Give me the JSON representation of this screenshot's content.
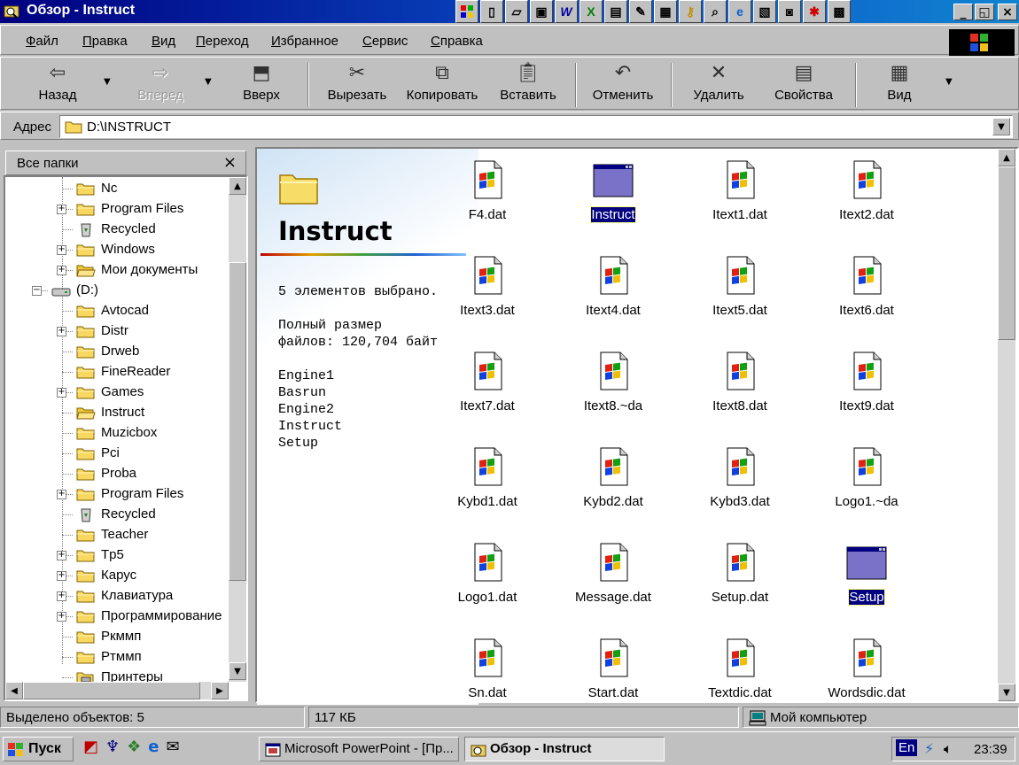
{
  "window": {
    "title": "Обзор - Instruct"
  },
  "menu": [
    "Файл",
    "Правка",
    "Вид",
    "Переход",
    "Избранное",
    "Сервис",
    "Справка"
  ],
  "toolbar": {
    "back": "Назад",
    "forward": "Вперед",
    "up": "Вверх",
    "cut": "Вырезать",
    "copy": "Копировать",
    "paste": "Вставить",
    "undo": "Отменить",
    "delete": "Удалить",
    "properties": "Свойства",
    "view": "Вид"
  },
  "address": {
    "label": "Адрес",
    "value": "D:\\INSTRUCT"
  },
  "folders": {
    "title": "Все папки",
    "close": "×",
    "items": [
      {
        "label": "Nc",
        "icon": "folder"
      },
      {
        "label": "Program Files",
        "icon": "folder",
        "expandable": true
      },
      {
        "label": "Recycled",
        "icon": "recycle-bin"
      },
      {
        "label": "Windows",
        "icon": "folder",
        "expandable": true
      },
      {
        "label": "Мои документы",
        "icon": "folder-open",
        "expandable": true
      },
      {
        "label": "(D:)",
        "icon": "drive",
        "expanded": true
      },
      {
        "label": "Avtocad",
        "icon": "folder"
      },
      {
        "label": "Distr",
        "icon": "folder",
        "expandable": true
      },
      {
        "label": "Drweb",
        "icon": "folder"
      },
      {
        "label": "FineReader",
        "icon": "folder"
      },
      {
        "label": "Games",
        "icon": "folder",
        "expandable": true
      },
      {
        "label": "Instruct",
        "icon": "folder-open"
      },
      {
        "label": "Muzicbox",
        "icon": "folder"
      },
      {
        "label": "Pci",
        "icon": "folder"
      },
      {
        "label": "Proba",
        "icon": "folder"
      },
      {
        "label": "Program Files",
        "icon": "folder",
        "expandable": true
      },
      {
        "label": "Recycled",
        "icon": "recycle-bin"
      },
      {
        "label": "Teacher",
        "icon": "folder"
      },
      {
        "label": "Tp5",
        "icon": "folder",
        "expandable": true
      },
      {
        "label": "Карус",
        "icon": "folder",
        "expandable": true
      },
      {
        "label": "Клавиатура",
        "icon": "folder",
        "expandable": true
      },
      {
        "label": "Программирование",
        "icon": "folder",
        "expandable": true
      },
      {
        "label": "Ркммп",
        "icon": "folder"
      },
      {
        "label": "Ртммп",
        "icon": "folder"
      },
      {
        "label": "Принтеры",
        "icon": "printer-folder"
      }
    ]
  },
  "info": {
    "folder_name": "Instruct",
    "selected": "5 элементов выбрано.",
    "size_line1": "Полный размер",
    "size_line2": "файлов: 120,704 байт",
    "names": [
      "Engine1",
      "Basrun",
      "Engine2",
      "Instruct",
      "Setup"
    ]
  },
  "files": [
    {
      "name": "F4.dat",
      "type": "dat"
    },
    {
      "name": "Instruct",
      "type": "exe",
      "selected": true
    },
    {
      "name": "Itext1.dat",
      "type": "dat"
    },
    {
      "name": "Itext2.dat",
      "type": "dat"
    },
    {
      "name": "Itext3.dat",
      "type": "dat"
    },
    {
      "name": "Itext4.dat",
      "type": "dat"
    },
    {
      "name": "Itext5.dat",
      "type": "dat"
    },
    {
      "name": "Itext6.dat",
      "type": "dat"
    },
    {
      "name": "Itext7.dat",
      "type": "dat"
    },
    {
      "name": "Itext8.~da",
      "type": "dat"
    },
    {
      "name": "Itext8.dat",
      "type": "dat"
    },
    {
      "name": "Itext9.dat",
      "type": "dat"
    },
    {
      "name": "Kybd1.dat",
      "type": "dat"
    },
    {
      "name": "Kybd2.dat",
      "type": "dat"
    },
    {
      "name": "Kybd3.dat",
      "type": "dat"
    },
    {
      "name": "Logo1.~da",
      "type": "dat"
    },
    {
      "name": "Logo1.dat",
      "type": "dat"
    },
    {
      "name": "Message.dat",
      "type": "dat"
    },
    {
      "name": "Setup.dat",
      "type": "dat"
    },
    {
      "name": "Setup",
      "type": "exe",
      "selected": true
    },
    {
      "name": "Sn.dat",
      "type": "dat"
    },
    {
      "name": "Start.dat",
      "type": "dat"
    },
    {
      "name": "Textdic.dat",
      "type": "dat"
    },
    {
      "name": "Wordsdic.dat",
      "type": "dat"
    }
  ],
  "status": {
    "objects": "Выделено объектов: 5",
    "size": "117 КБ",
    "location": "Мой компьютер"
  },
  "taskbar": {
    "start": "Пуск",
    "tasks": [
      "Microsoft PowerPoint - [Пр...",
      "Обзор - Instruct"
    ],
    "lang": "En",
    "clock": "23:39"
  },
  "colors": {
    "titlebar": "#000080",
    "selection": "#000080",
    "face": "#c0c0c0"
  }
}
